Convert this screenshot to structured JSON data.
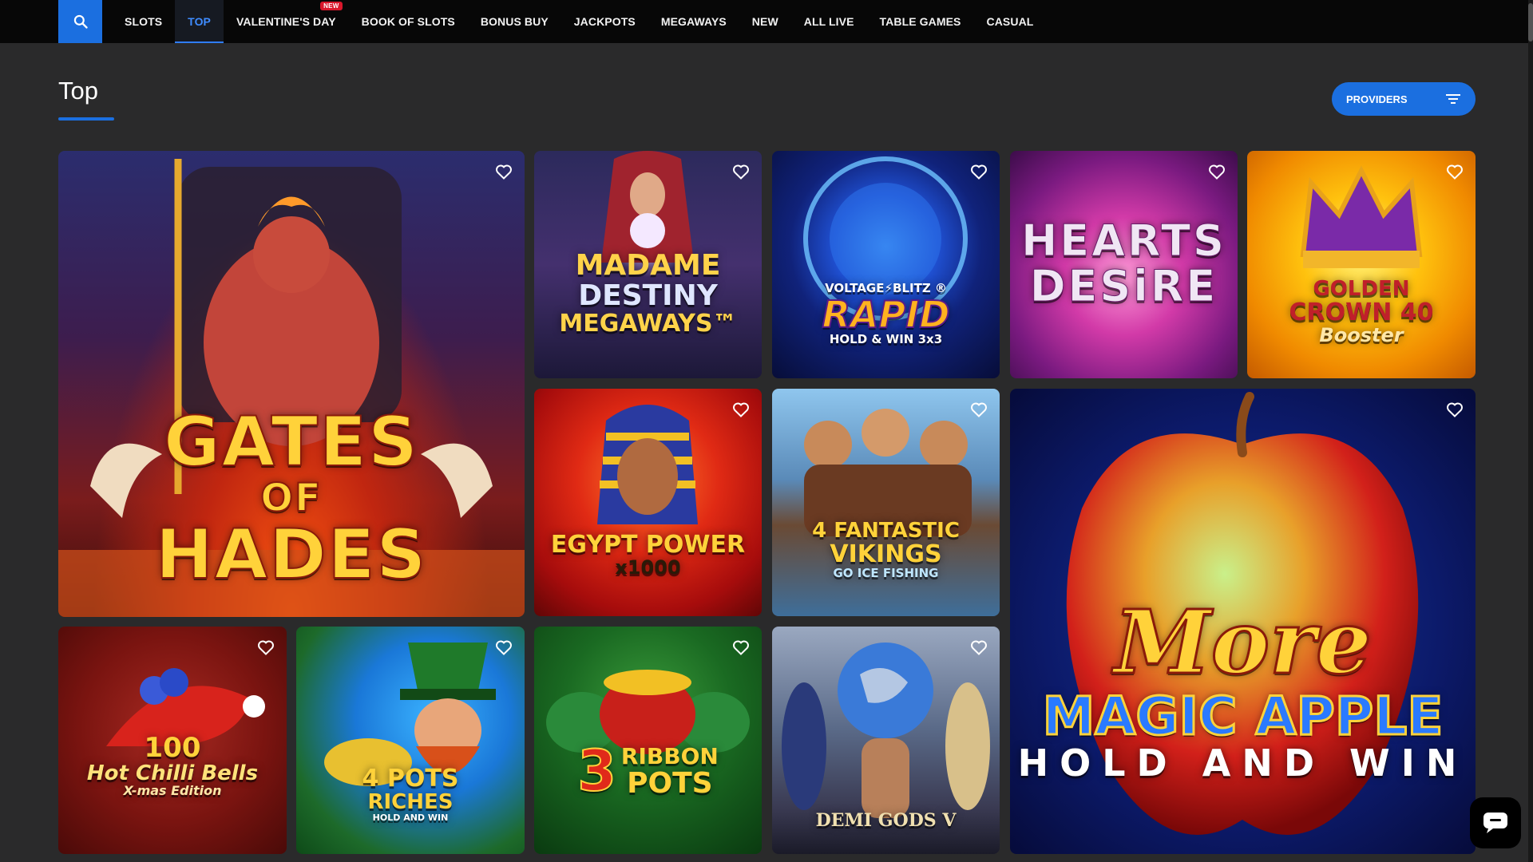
{
  "nav": {
    "items": [
      {
        "label": "SLOTS"
      },
      {
        "label": "TOP",
        "active": true
      },
      {
        "label": "VALENTINE'S DAY",
        "badge": "NEW"
      },
      {
        "label": "BOOK OF SLOTS"
      },
      {
        "label": "BONUS BUY"
      },
      {
        "label": "JACKPOTS"
      },
      {
        "label": "MEGAWAYS"
      },
      {
        "label": "NEW"
      },
      {
        "label": "ALL LIVE"
      },
      {
        "label": "TABLE GAMES"
      },
      {
        "label": "CASUAL"
      }
    ]
  },
  "page": {
    "title": "Top",
    "providers_label": "PROVIDERS"
  },
  "games": [
    {
      "id": "gates-of-hades",
      "title_lines": [
        "GATES",
        "OF",
        "HADES"
      ]
    },
    {
      "id": "madame-destiny",
      "title_lines": [
        "MADAME",
        "DESTINY",
        "MEGAWAYS™"
      ]
    },
    {
      "id": "voltage-blitz",
      "title_lines": [
        "VOLTAGE⚡BLITZ ®",
        "RAPID",
        "HOLD & WIN 3x3"
      ]
    },
    {
      "id": "hearts-desire",
      "title_lines": [
        "HEARTS",
        "DESiRE"
      ]
    },
    {
      "id": "golden-crown",
      "title_lines": [
        "GOLDEN",
        "CROWN 40",
        "Booster"
      ]
    },
    {
      "id": "egypt-power",
      "title_lines": [
        "EGYPT POWER",
        "x1000"
      ]
    },
    {
      "id": "fantastic-vikings",
      "title_lines": [
        "4 FANTASTIC",
        "VIKINGS",
        "GO ICE FISHING"
      ]
    },
    {
      "id": "more-magic-apple",
      "title_lines": [
        "More",
        "MAGIC APPLE",
        "HOLD AND WIN"
      ]
    },
    {
      "id": "hot-chilli-bells",
      "title_lines": [
        "100",
        "Hot Chilli Bells",
        "X-mas Edition"
      ]
    },
    {
      "id": "pots-riches",
      "title_lines": [
        "4 POTS",
        "RICHES",
        "HOLD AND WIN"
      ]
    },
    {
      "id": "ribbon-pots",
      "title_lines": [
        "3",
        "RIBBON",
        "POTS"
      ]
    },
    {
      "id": "demi-gods",
      "title_lines": [
        "DEMI GODS V"
      ]
    }
  ],
  "colors": {
    "accent": "#1b6fe0",
    "active_nav": "#3f8cff",
    "badge": "#d8172b",
    "background": "#2a2a2b"
  },
  "icons": {
    "search": "search-icon",
    "filter": "filter-icon",
    "favorite": "heart-outline-icon",
    "chat": "chat-icon"
  }
}
